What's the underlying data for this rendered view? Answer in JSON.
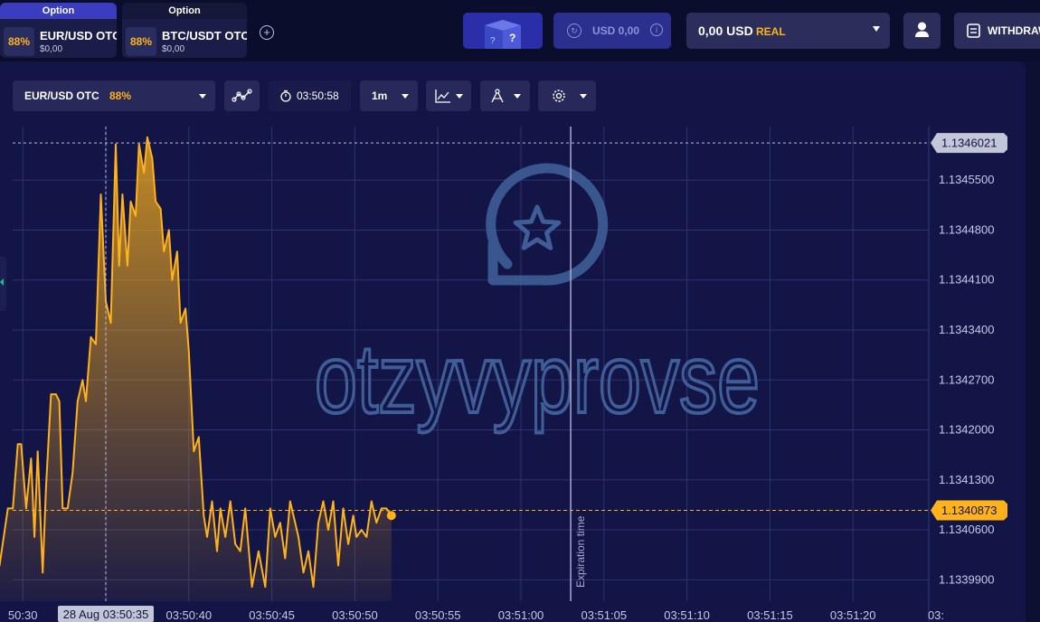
{
  "tabs": [
    {
      "header": "Option",
      "payout": "88%",
      "name": "EUR/USD OTC",
      "amount": "$0,00"
    },
    {
      "header": "Option",
      "payout": "88%",
      "name": "BTC/USDT OTC",
      "amount": "$0,00"
    }
  ],
  "header": {
    "add_tab": "+",
    "gift_mark": "?",
    "demo_balance": "USD 0,00",
    "balance_amount": "0,00 USD",
    "balance_type": "REAL",
    "withdraw_label": "WITHDRAW"
  },
  "toolbar": {
    "asset_name": "EUR/USD OTC",
    "asset_payout": "88%",
    "timer": "03:50:58",
    "timeframe": "1m"
  },
  "chart_data": {
    "type": "area",
    "line_color": "#ffb21a",
    "x_ticks": [
      "50:30",
      "03:50:35",
      "03:50:40",
      "03:50:45",
      "03:50:50",
      "03:50:55",
      "03:51:00",
      "03:51:05",
      "03:51:10",
      "03:51:15",
      "03:51:20",
      "03:"
    ],
    "crosshair_label": "28 Aug 03:50:35",
    "y_ticks": [
      "1.1345500",
      "1.1344800",
      "1.1344100",
      "1.1343400",
      "1.1342700",
      "1.1342000",
      "1.1341300",
      "1.1340600",
      "1.1339900"
    ],
    "ylim": [
      1.13396,
      1.134625
    ],
    "high_label": "1.1346021",
    "current_label": "1.1340873",
    "current_value": 1.1340873,
    "expiration_label": "Expiration time",
    "expiration_time_s": 1.0,
    "series": [
      {
        "x": [
          -7.0,
          -6.8,
          -6.4,
          -5.9,
          -5.6,
          -5.3,
          -5.1,
          -4.8,
          -4.5,
          -4.3,
          -4.1,
          -3.8,
          -3.6,
          -3.3,
          -3.0,
          -2.8,
          -2.6,
          -2.3,
          -2.0,
          -1.7,
          -1.4,
          -1.2,
          -0.9,
          -0.6,
          -0.3,
          0.0,
          0.3,
          0.6,
          0.8,
          1.0,
          1.3,
          1.5,
          1.8,
          2.0,
          2.3,
          2.5,
          2.8,
          3.0,
          3.3,
          3.5,
          3.8,
          4.0,
          4.3,
          4.5,
          4.8,
          5.0,
          5.3,
          5.6,
          5.9,
          6.1,
          6.4,
          6.7,
          6.9,
          7.2,
          7.5,
          7.8,
          8.1,
          8.4,
          8.8,
          9.2,
          9.6,
          9.9,
          10.2,
          10.5,
          10.8,
          11.1,
          11.3,
          11.6,
          11.9,
          12.2,
          12.5,
          12.8,
          13.1,
          13.4,
          13.7,
          14.0,
          14.3,
          14.6,
          14.9,
          15.1,
          15.4,
          15.7,
          16.0,
          16.3,
          16.6,
          16.9,
          17.2
        ],
        "y": [
          1.134,
          1.13399,
          1.13401,
          1.13409,
          1.13409,
          1.13418,
          1.13418,
          1.13409,
          1.13416,
          1.13405,
          1.13417,
          1.134,
          1.13412,
          1.13425,
          1.13425,
          1.13424,
          1.13409,
          1.13409,
          1.13414,
          1.13424,
          1.13427,
          1.13424,
          1.13433,
          1.13432,
          1.13453,
          1.13438,
          1.13435,
          1.1346,
          1.13443,
          1.13453,
          1.13443,
          1.13452,
          1.1345,
          1.1346,
          1.13456,
          1.13461,
          1.13458,
          1.13452,
          1.13451,
          1.13445,
          1.13448,
          1.13441,
          1.13445,
          1.13435,
          1.13437,
          1.13431,
          1.13417,
          1.13419,
          1.13408,
          1.13405,
          1.1341,
          1.13403,
          1.13409,
          1.13405,
          1.1341,
          1.13404,
          1.13403,
          1.13409,
          1.13398,
          1.13403,
          1.13398,
          1.13409,
          1.13405,
          1.13407,
          1.13402,
          1.1341,
          1.13408,
          1.13405,
          1.134,
          1.13403,
          1.13398,
          1.13407,
          1.1341,
          1.13406,
          1.1341,
          1.13401,
          1.13409,
          1.13404,
          1.13408,
          1.13405,
          1.13406,
          1.13405,
          1.1341,
          1.13407,
          1.13409,
          1.13409,
          1.13408
        ]
      }
    ]
  },
  "watermark": {
    "text": "otzyvyprovse",
    "color": "#3f5d96"
  }
}
